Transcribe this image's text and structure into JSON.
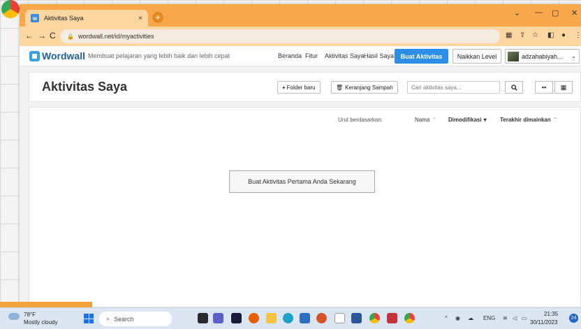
{
  "browser": {
    "tab_title": "Aktivitas Saya",
    "tab_close": "×",
    "new_tab": "+",
    "url": "wordwall.net/id/myactivities",
    "win_minimize": "—",
    "win_maximize": "▢",
    "win_close": "✕",
    "win_menu": "⌄"
  },
  "header": {
    "logo": "Wordwall",
    "tagline": "Membuat pelajaran yang lebih baik dan lebih cepat",
    "nav": [
      "Beranda",
      "Fitur",
      "Aktivitas Saya",
      "Hasil Saya"
    ],
    "create_button": "Buat Aktivitas",
    "upgrade_button": "Naikkan Level",
    "user_name": "adzahabiyah..."
  },
  "page": {
    "title": "Aktivitas Saya",
    "new_folder": "Folder baru",
    "trash": "Keranjang Sampah",
    "search_placeholder": "Cari aktivitas saya...",
    "sort_label": "Urut berdasarkan:",
    "sort_options": [
      "Nama",
      "Dimodifikasi",
      "Terakhir dimainkan"
    ],
    "create_first": "Buat Aktivitas Pertama Anda Sekarang"
  },
  "taskbar": {
    "temperature": "78°F",
    "weather": "Mostly cloudy",
    "search": "Search",
    "language": "ENG",
    "time": "21:35",
    "date": "30/11/2023",
    "badge": "24"
  },
  "colors": {
    "tabstrip": "#f8a84a",
    "accent": "#2d8ee8",
    "logo": "#1e5f96"
  }
}
